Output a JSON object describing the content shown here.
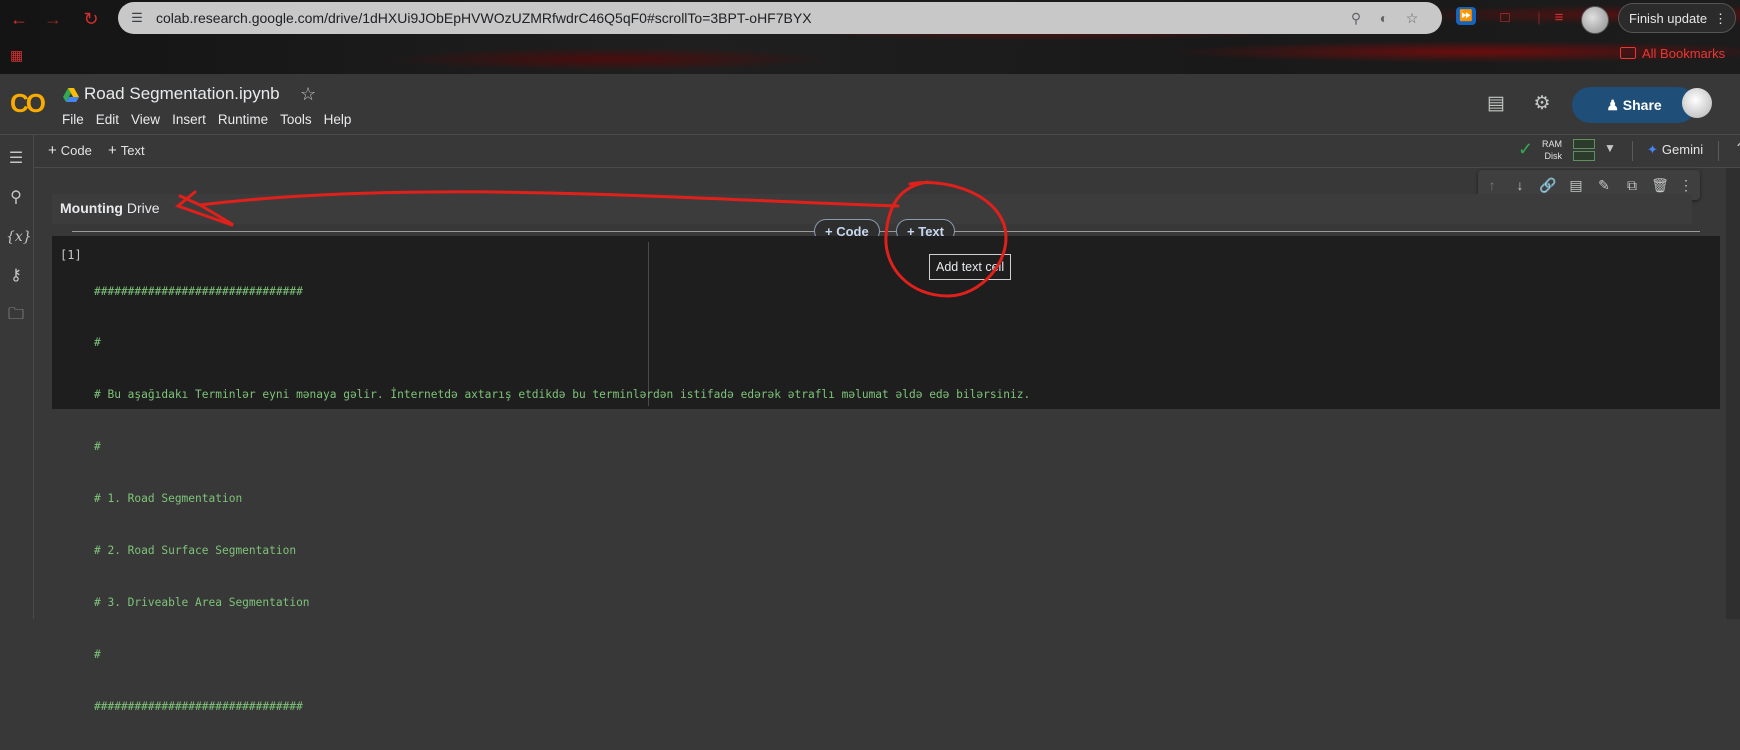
{
  "browser": {
    "url": "colab.research.google.com/drive/1dHXUi9JObEpHVWOzUZMRfwdrC46Q5qF0#scrollTo=3BPT-oHF7BYX",
    "finish_update_label": "Finish update",
    "bookmarks_label": "All Bookmarks"
  },
  "colab": {
    "logo_text": "CO",
    "notebook_title": "Road Segmentation.ipynb",
    "menu": [
      "File",
      "Edit",
      "View",
      "Insert",
      "Runtime",
      "Tools",
      "Help"
    ],
    "share_label": "Share"
  },
  "toolbar": {
    "add_code_label": "Code",
    "add_text_label": "Text",
    "ram_label": "RAM",
    "disk_label": "Disk",
    "gemini_label": "Gemini"
  },
  "text_cell": {
    "heading_bold": "Mounting",
    "heading_rest": " Drive"
  },
  "insert_pills": {
    "code_label": "Code",
    "text_label": "Text"
  },
  "tooltip": "Add text cell",
  "code_cell": {
    "execution_count": "[1]",
    "lines": [
      "###############################",
      "#",
      "# Bu aşağıdakı Terminlər eyni mənaya gəlir. İnternetdə axtarış etdikdə bu terminlərdən istifadə edərək ətraflı məlumat əldə edə bilərsiniz.",
      "#",
      "# 1. Road Segmentation",
      "# 2. Road Surface Segmentation",
      "# 3. Driveable Area Segmentation",
      "#",
      "###############################"
    ]
  },
  "colors": {
    "annotation_red": "#e0201b",
    "code_comment_green": "#7ec379",
    "share_blue": "#1f4e79"
  }
}
